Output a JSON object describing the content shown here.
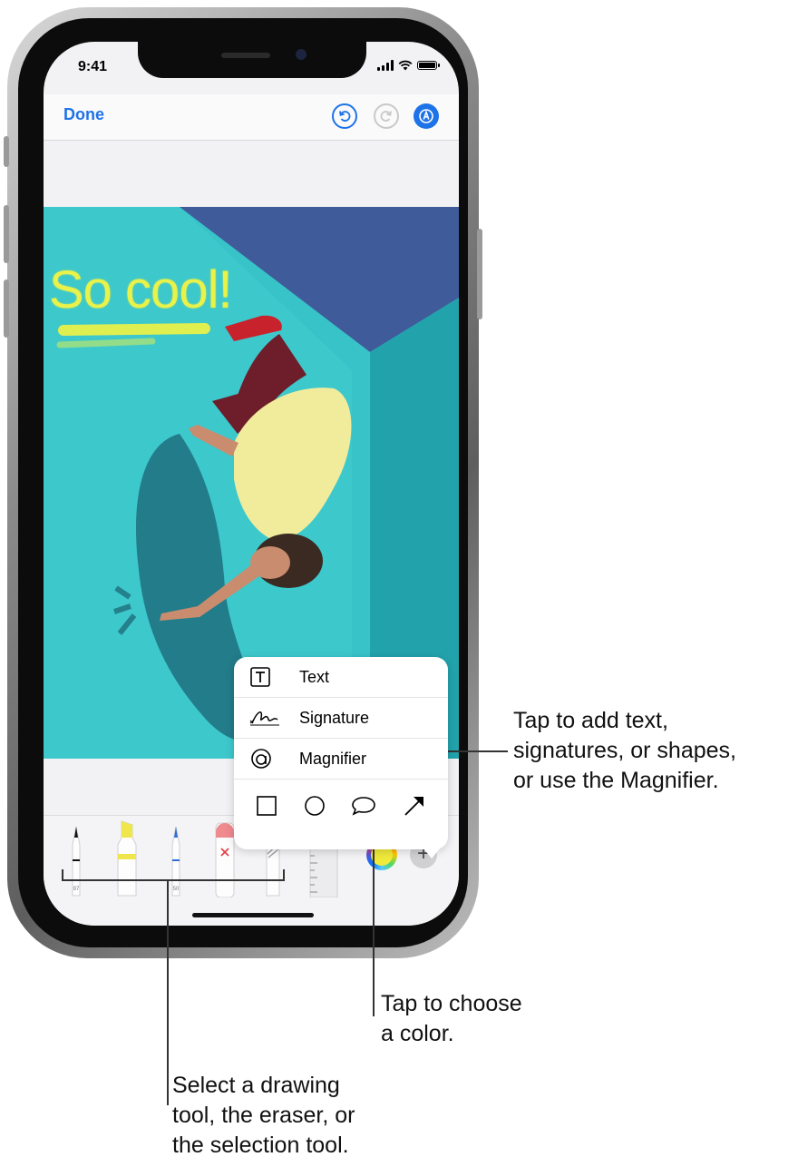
{
  "status_bar": {
    "time": "9:41"
  },
  "toolbar": {
    "done_label": "Done"
  },
  "icons": {
    "undo": "undo-icon",
    "redo": "redo-icon",
    "markup": "markup-pen-icon",
    "add": "plus-icon",
    "color": "color-wheel-icon"
  },
  "photo": {
    "overlay_text": "So cool!"
  },
  "popover": {
    "items": [
      {
        "label": "Text",
        "icon": "text-box-icon"
      },
      {
        "label": "Signature",
        "icon": "signature-icon"
      },
      {
        "label": "Magnifier",
        "icon": "magnifier-icon"
      }
    ],
    "shapes": [
      "square-icon",
      "circle-icon",
      "speech-bubble-icon",
      "arrow-icon"
    ]
  },
  "tools": {
    "pen_width": "97",
    "pencil_width": "50",
    "items": [
      "pen",
      "highlighter",
      "pencil",
      "eraser",
      "lasso",
      "ruler"
    ]
  },
  "add_button_glyph": "+",
  "colors": {
    "accent": "#1e73e8",
    "highlight": "#e8f24a",
    "selected_color": "#f0ea3a"
  },
  "callouts": {
    "add": [
      "Tap to add text,",
      "signatures, or shapes,",
      "or use the Magnifier."
    ],
    "color": [
      "Tap to choose",
      "a color."
    ],
    "tools": [
      "Select a drawing",
      "tool, the eraser, or",
      "the selection tool."
    ]
  }
}
